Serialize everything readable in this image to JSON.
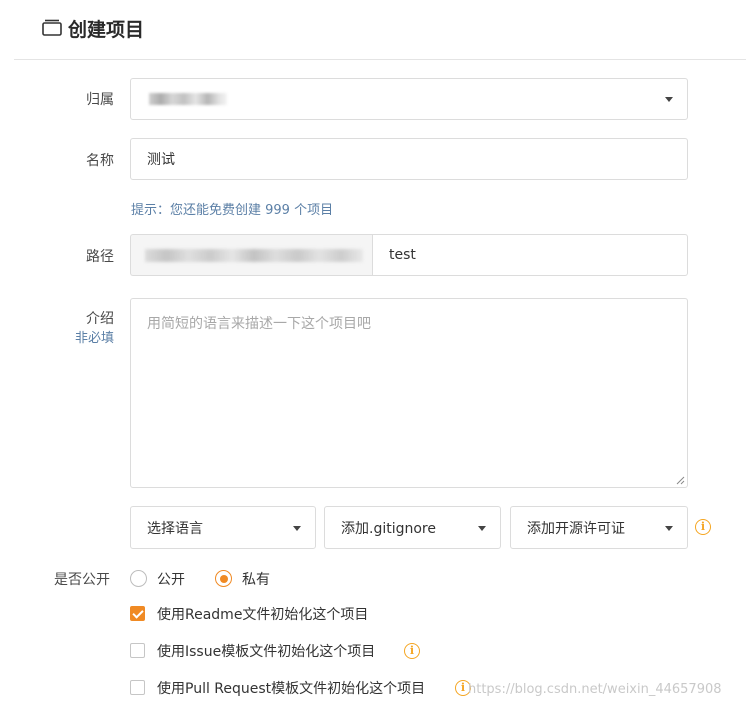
{
  "header": {
    "title": "创建项目",
    "icon": "folder-stack-icon"
  },
  "form": {
    "owner": {
      "label": "归属"
    },
    "name": {
      "label": "名称",
      "value": "测试"
    },
    "hint": "提示：您还能免费创建 999 个项目",
    "path": {
      "label": "路径",
      "value": "test"
    },
    "intro": {
      "label": "介绍",
      "sublabel": "非必填",
      "placeholder": "用简短的语言来描述一下这个项目吧"
    },
    "selects": {
      "language": "选择语言",
      "gitignore": "添加.gitignore",
      "license": "添加开源许可证"
    },
    "visibility": {
      "label": "是否公开",
      "options": [
        "公开",
        "私有"
      ],
      "selected": "私有"
    },
    "checkboxes": [
      {
        "label": "使用Readme文件初始化这个项目",
        "checked": true
      },
      {
        "label": "使用Issue模板文件初始化这个项目",
        "checked": false
      },
      {
        "label": "使用Pull Request模板文件初始化这个项目",
        "checked": false
      }
    ]
  },
  "watermark": "https://blog.csdn.net/weixin_44657908",
  "colors": {
    "accent": "#f08a24",
    "info": "#f5a623",
    "hint": "#5b7fa6",
    "border": "#dcdcdc"
  }
}
